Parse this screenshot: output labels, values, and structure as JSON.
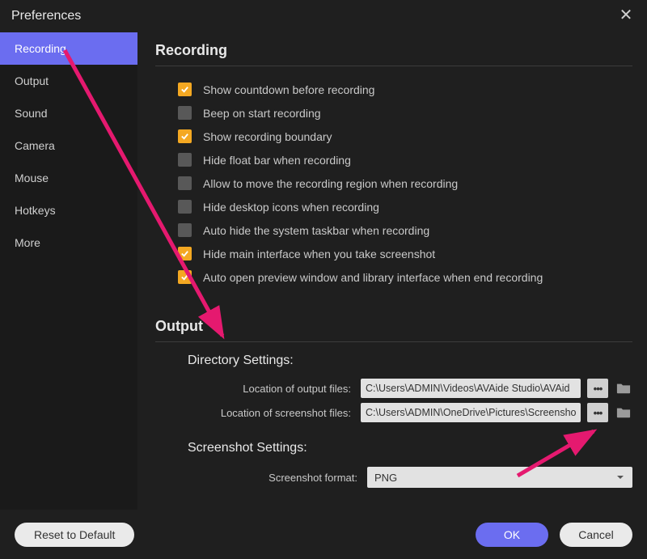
{
  "title": "Preferences",
  "sidebar": {
    "items": [
      {
        "label": "Recording",
        "active": true
      },
      {
        "label": "Output",
        "active": false
      },
      {
        "label": "Sound",
        "active": false
      },
      {
        "label": "Camera",
        "active": false
      },
      {
        "label": "Mouse",
        "active": false
      },
      {
        "label": "Hotkeys",
        "active": false
      },
      {
        "label": "More",
        "active": false
      }
    ]
  },
  "sections": {
    "recording": {
      "title": "Recording",
      "options": [
        {
          "label": "Show countdown before recording",
          "checked": true
        },
        {
          "label": "Beep on start recording",
          "checked": false
        },
        {
          "label": "Show recording boundary",
          "checked": true
        },
        {
          "label": "Hide float bar when recording",
          "checked": false
        },
        {
          "label": "Allow to move the recording region when recording",
          "checked": false
        },
        {
          "label": "Hide desktop icons when recording",
          "checked": false
        },
        {
          "label": "Auto hide the system taskbar when recording",
          "checked": false
        },
        {
          "label": "Hide main interface when you take screenshot",
          "checked": true
        },
        {
          "label": "Auto open preview window and library interface when end recording",
          "checked": true
        }
      ]
    },
    "output": {
      "title": "Output",
      "dir_title": "Directory Settings:",
      "output_label": "Location of output files:",
      "output_path": "C:\\Users\\ADMIN\\Videos\\AVAide Studio\\AVAid",
      "screenshot_label": "Location of screenshot files:",
      "screenshot_path": "C:\\Users\\ADMIN\\OneDrive\\Pictures\\Screensho",
      "ss_title": "Screenshot Settings:",
      "format_label": "Screenshot format:",
      "format_value": "PNG"
    }
  },
  "footer": {
    "reset": "Reset to Default",
    "ok": "OK",
    "cancel": "Cancel"
  },
  "colors": {
    "accent": "#6b6df0",
    "checkbox_on": "#f4a822",
    "annotation": "#e5196f"
  }
}
